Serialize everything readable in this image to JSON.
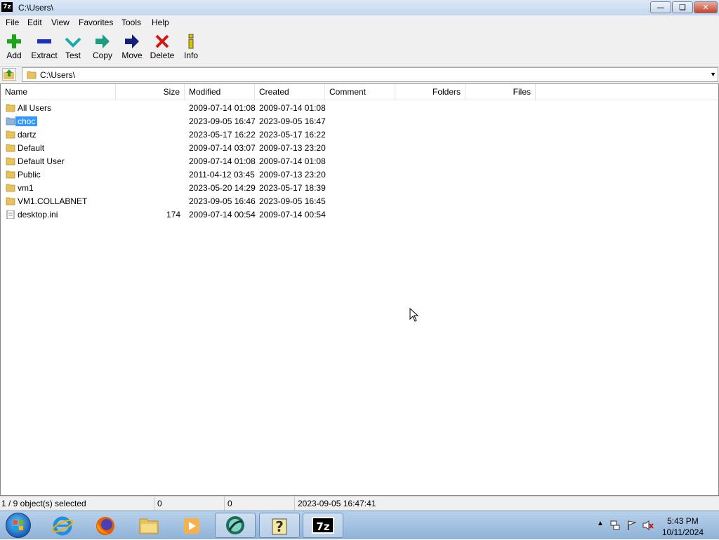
{
  "window": {
    "title": "C:\\Users\\",
    "app_icon": "7z",
    "min_icon": "minimize-icon",
    "max_icon": "restore-icon",
    "close_icon": "close-icon"
  },
  "menu": [
    "File",
    "Edit",
    "View",
    "Favorites",
    "Tools",
    "Help"
  ],
  "toolbar": [
    {
      "label": "Add",
      "icon": "plus-icon",
      "color": "#1aa51a"
    },
    {
      "label": "Extract",
      "icon": "minus-icon",
      "color": "#1b2fb8"
    },
    {
      "label": "Test",
      "icon": "check-icon",
      "color": "#19a9a9"
    },
    {
      "label": "Copy",
      "icon": "arrow-right-icon",
      "color": "#1c9c80"
    },
    {
      "label": "Move",
      "icon": "arrow-right-icon",
      "color": "#12207a"
    },
    {
      "label": "Delete",
      "icon": "x-icon",
      "color": "#d11616"
    },
    {
      "label": "Info",
      "icon": "info-icon",
      "color": "#d8c400"
    }
  ],
  "address": {
    "path": "C:\\Users\\"
  },
  "columns": [
    "Name",
    "Size",
    "Modified",
    "Created",
    "Comment",
    "Folders",
    "Files"
  ],
  "rows": [
    {
      "name": "All Users",
      "size": "",
      "modified": "2009-07-14 01:08",
      "created": "2009-07-14 01:08",
      "type": "folder"
    },
    {
      "name": "choc",
      "size": "",
      "modified": "2023-09-05 16:47",
      "created": "2023-09-05 16:47",
      "type": "folder",
      "selected": true
    },
    {
      "name": "dartz",
      "size": "",
      "modified": "2023-05-17 16:22",
      "created": "2023-05-17 16:22",
      "type": "folder"
    },
    {
      "name": "Default",
      "size": "",
      "modified": "2009-07-14 03:07",
      "created": "2009-07-13 23:20",
      "type": "folder"
    },
    {
      "name": "Default User",
      "size": "",
      "modified": "2009-07-14 01:08",
      "created": "2009-07-14 01:08",
      "type": "folder"
    },
    {
      "name": "Public",
      "size": "",
      "modified": "2011-04-12 03:45",
      "created": "2009-07-13 23:20",
      "type": "folder"
    },
    {
      "name": "vm1",
      "size": "",
      "modified": "2023-05-20 14:29",
      "created": "2023-05-17 18:39",
      "type": "folder"
    },
    {
      "name": "VM1.COLLABNET",
      "size": "",
      "modified": "2023-09-05 16:46",
      "created": "2023-09-05 16:45",
      "type": "folder"
    },
    {
      "name": "desktop.ini",
      "size": "174",
      "modified": "2009-07-14 00:54",
      "created": "2009-07-14 00:54",
      "type": "file"
    }
  ],
  "status": {
    "selection": "1 / 9 object(s) selected",
    "size": "0",
    "packed": "0",
    "modified": "2023-09-05 16:47:41"
  },
  "taskbar": {
    "apps": [
      "internet-explorer-icon",
      "firefox-icon",
      "file-explorer-icon",
      "media-player-icon",
      "app-icon",
      "help-icon",
      "7zip-icon"
    ],
    "clock_time": "5:43 PM",
    "clock_date": "10/11/2024"
  },
  "colors": {
    "selection": "#3399ff",
    "folder": "#e8c25a",
    "titlebar": "#c4d7ee"
  }
}
